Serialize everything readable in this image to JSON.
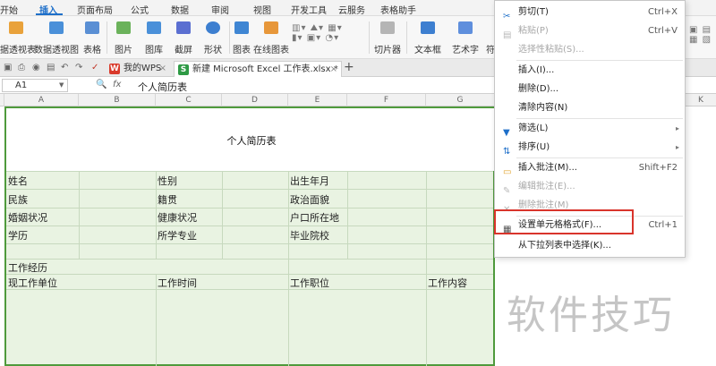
{
  "ribbon_tabs": {
    "items": [
      "开始",
      "插入",
      "页面布局",
      "公式",
      "数据",
      "审阅",
      "视图",
      "开发工具",
      "云服务",
      "表格助手"
    ]
  },
  "ribbon": {
    "pivot_table": "据透视表",
    "pivot_chart": "数据透视图",
    "table": "表格",
    "picture": "图片",
    "gallery": "图库",
    "screenshot": "截屏",
    "shapes": "形状",
    "chart": "图表",
    "online_chart": "在线图表",
    "slicer": "切片器",
    "textbox": "文本框",
    "wordart": "艺术字",
    "symbol": "符"
  },
  "doc_tabs": {
    "wps_label": "我的WPS",
    "excel_label": "新建 Microsoft Excel 工作表.xlsx *",
    "close": "×",
    "new_tab": "+"
  },
  "formula_bar": {
    "name_box": "A1",
    "fx": "fx",
    "content": "个人简历表"
  },
  "columns": [
    "A",
    "B",
    "C",
    "D",
    "E",
    "F",
    "G",
    "K"
  ],
  "sheet": {
    "title": "个人简历表",
    "name_label": "姓名",
    "gender_label": "性别",
    "birth_label": "出生年月",
    "ethnicity_label": "民族",
    "native_label": "籍贯",
    "political_label": "政治面貌",
    "marital_label": "婚姻状况",
    "health_label": "健康状况",
    "residence_label": "户口所在地",
    "education_label": "学历",
    "major_label": "所学专业",
    "school_label": "毕业院校",
    "experience_label": "工作经历",
    "company_label": "现工作单位",
    "work_time_label": "工作时间",
    "position_label": "工作职位",
    "work_content_label": "工作内容"
  },
  "context_menu": {
    "cut": "剪切(T)",
    "cut_shortcut": "Ctrl+X",
    "paste": "粘贴(P)",
    "paste_shortcut": "Ctrl+V",
    "paste_special": "选择性粘贴(S)...",
    "insert": "插入(I)...",
    "delete": "删除(D)...",
    "clear": "清除内容(N)",
    "filter": "筛选(L)",
    "sort": "排序(U)",
    "insert_comment": "插入批注(M)...",
    "insert_comment_shortcut": "Shift+F2",
    "edit_comment": "编辑批注(E)...",
    "delete_comment": "删除批注(M)",
    "format_cells": "设置单元格格式(F)...",
    "format_cells_shortcut": "Ctrl+1",
    "pick_from_list": "从下拉列表中选择(K)..."
  },
  "watermark": "软件技巧",
  "colors": {
    "accent": "#1e6fc9",
    "selection_fill": "#e9f3e2",
    "selection_border": "#4f9a3c",
    "highlight_red": "#d9342b"
  }
}
